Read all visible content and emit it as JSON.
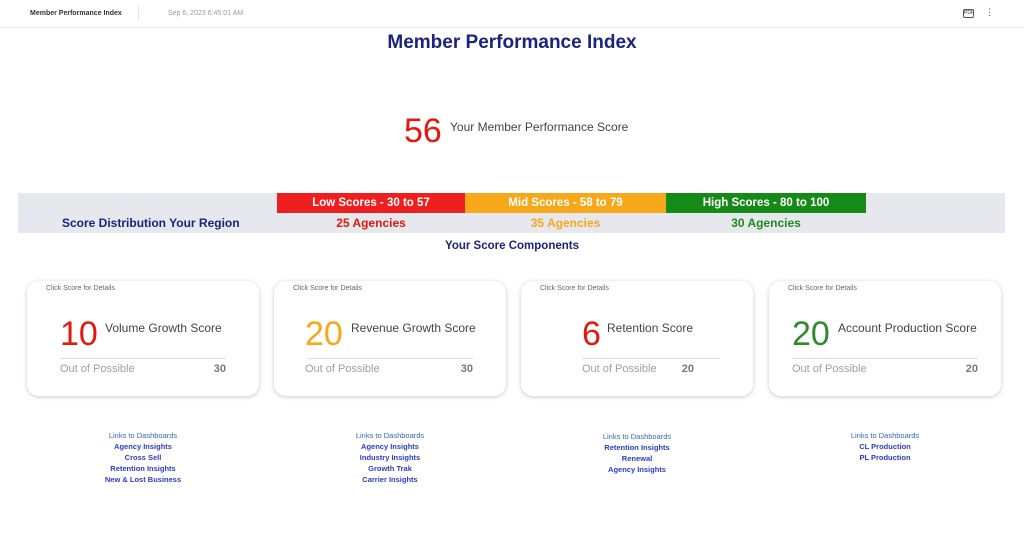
{
  "topbar": {
    "title": "Member Performance Index",
    "timestamp": "Sep 6, 2023 6:45:01 AM",
    "badge_icon_text": "PDF",
    "more_icon": "⋮"
  },
  "page_title": "Member Performance Index",
  "member_score": {
    "value": "56",
    "label": "Your Member Performance Score",
    "color": "#e3190f"
  },
  "distribution": {
    "label": "Score Distribution Your Region",
    "ranges": [
      {
        "label": "Low Scores - 30 to 57",
        "count": "25 Agencies",
        "color": "#ef1f1f"
      },
      {
        "label": "Mid Scores - 58 to 79",
        "count": "35 Agencies",
        "color": "#f7a71a"
      },
      {
        "label": "High Scores - 80 to 100",
        "count": "30 Agencies",
        "color": "#168a16"
      }
    ]
  },
  "components_title": "Your Score Components",
  "cards": [
    {
      "hint": "Click Score for Details",
      "score": "10",
      "name": "Volume Growth Score",
      "oop_label": "Out of Possible",
      "possible": "30"
    },
    {
      "hint": "Click Score for Details",
      "score": "20",
      "name": "Revenue Growth Score",
      "oop_label": "Out of Possible",
      "possible": "30"
    },
    {
      "hint": "Click Score for Details",
      "score": "6",
      "name": "Retention Score",
      "oop_label": "Out of Possible",
      "possible": "20"
    },
    {
      "hint": "Click Score for Details",
      "score": "20",
      "name": "Account Production Score",
      "oop_label": "Out of Possible",
      "possible": "20"
    }
  ],
  "links": [
    {
      "heading": "Links to Dashboards",
      "items": [
        "Agency Insights",
        "Cross Sell",
        "Retention Insights",
        "New & Lost Business"
      ]
    },
    {
      "heading": "Links to Dashboards",
      "items": [
        "Agency Insights",
        "Industry Insights",
        "Growth Trak",
        "Carrier Insights"
      ]
    },
    {
      "heading": "Links to Dashboards",
      "items": [
        "Retention Insights",
        "Renewal",
        "Agency Insights"
      ]
    },
    {
      "heading": "Links to Dashboards",
      "items": [
        "CL Production",
        "PL Production"
      ]
    }
  ]
}
